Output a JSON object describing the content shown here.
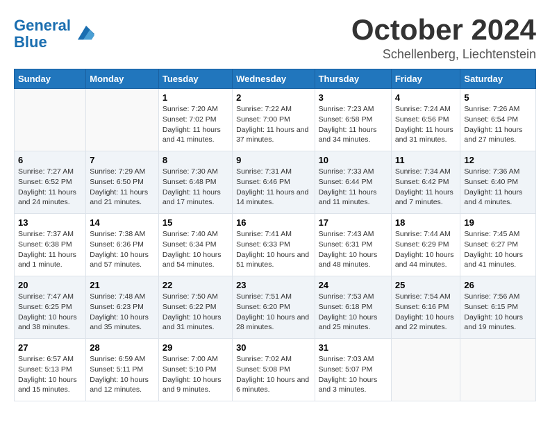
{
  "header": {
    "logo_line1": "General",
    "logo_line2": "Blue",
    "month": "October 2024",
    "location": "Schellenberg, Liechtenstein"
  },
  "weekdays": [
    "Sunday",
    "Monday",
    "Tuesday",
    "Wednesday",
    "Thursday",
    "Friday",
    "Saturday"
  ],
  "weeks": [
    [
      {
        "day": "",
        "sunrise": "",
        "sunset": "",
        "daylight": ""
      },
      {
        "day": "",
        "sunrise": "",
        "sunset": "",
        "daylight": ""
      },
      {
        "day": "1",
        "sunrise": "Sunrise: 7:20 AM",
        "sunset": "Sunset: 7:02 PM",
        "daylight": "Daylight: 11 hours and 41 minutes."
      },
      {
        "day": "2",
        "sunrise": "Sunrise: 7:22 AM",
        "sunset": "Sunset: 7:00 PM",
        "daylight": "Daylight: 11 hours and 37 minutes."
      },
      {
        "day": "3",
        "sunrise": "Sunrise: 7:23 AM",
        "sunset": "Sunset: 6:58 PM",
        "daylight": "Daylight: 11 hours and 34 minutes."
      },
      {
        "day": "4",
        "sunrise": "Sunrise: 7:24 AM",
        "sunset": "Sunset: 6:56 PM",
        "daylight": "Daylight: 11 hours and 31 minutes."
      },
      {
        "day": "5",
        "sunrise": "Sunrise: 7:26 AM",
        "sunset": "Sunset: 6:54 PM",
        "daylight": "Daylight: 11 hours and 27 minutes."
      }
    ],
    [
      {
        "day": "6",
        "sunrise": "Sunrise: 7:27 AM",
        "sunset": "Sunset: 6:52 PM",
        "daylight": "Daylight: 11 hours and 24 minutes."
      },
      {
        "day": "7",
        "sunrise": "Sunrise: 7:29 AM",
        "sunset": "Sunset: 6:50 PM",
        "daylight": "Daylight: 11 hours and 21 minutes."
      },
      {
        "day": "8",
        "sunrise": "Sunrise: 7:30 AM",
        "sunset": "Sunset: 6:48 PM",
        "daylight": "Daylight: 11 hours and 17 minutes."
      },
      {
        "day": "9",
        "sunrise": "Sunrise: 7:31 AM",
        "sunset": "Sunset: 6:46 PM",
        "daylight": "Daylight: 11 hours and 14 minutes."
      },
      {
        "day": "10",
        "sunrise": "Sunrise: 7:33 AM",
        "sunset": "Sunset: 6:44 PM",
        "daylight": "Daylight: 11 hours and 11 minutes."
      },
      {
        "day": "11",
        "sunrise": "Sunrise: 7:34 AM",
        "sunset": "Sunset: 6:42 PM",
        "daylight": "Daylight: 11 hours and 7 minutes."
      },
      {
        "day": "12",
        "sunrise": "Sunrise: 7:36 AM",
        "sunset": "Sunset: 6:40 PM",
        "daylight": "Daylight: 11 hours and 4 minutes."
      }
    ],
    [
      {
        "day": "13",
        "sunrise": "Sunrise: 7:37 AM",
        "sunset": "Sunset: 6:38 PM",
        "daylight": "Daylight: 11 hours and 1 minute."
      },
      {
        "day": "14",
        "sunrise": "Sunrise: 7:38 AM",
        "sunset": "Sunset: 6:36 PM",
        "daylight": "Daylight: 10 hours and 57 minutes."
      },
      {
        "day": "15",
        "sunrise": "Sunrise: 7:40 AM",
        "sunset": "Sunset: 6:34 PM",
        "daylight": "Daylight: 10 hours and 54 minutes."
      },
      {
        "day": "16",
        "sunrise": "Sunrise: 7:41 AM",
        "sunset": "Sunset: 6:33 PM",
        "daylight": "Daylight: 10 hours and 51 minutes."
      },
      {
        "day": "17",
        "sunrise": "Sunrise: 7:43 AM",
        "sunset": "Sunset: 6:31 PM",
        "daylight": "Daylight: 10 hours and 48 minutes."
      },
      {
        "day": "18",
        "sunrise": "Sunrise: 7:44 AM",
        "sunset": "Sunset: 6:29 PM",
        "daylight": "Daylight: 10 hours and 44 minutes."
      },
      {
        "day": "19",
        "sunrise": "Sunrise: 7:45 AM",
        "sunset": "Sunset: 6:27 PM",
        "daylight": "Daylight: 10 hours and 41 minutes."
      }
    ],
    [
      {
        "day": "20",
        "sunrise": "Sunrise: 7:47 AM",
        "sunset": "Sunset: 6:25 PM",
        "daylight": "Daylight: 10 hours and 38 minutes."
      },
      {
        "day": "21",
        "sunrise": "Sunrise: 7:48 AM",
        "sunset": "Sunset: 6:23 PM",
        "daylight": "Daylight: 10 hours and 35 minutes."
      },
      {
        "day": "22",
        "sunrise": "Sunrise: 7:50 AM",
        "sunset": "Sunset: 6:22 PM",
        "daylight": "Daylight: 10 hours and 31 minutes."
      },
      {
        "day": "23",
        "sunrise": "Sunrise: 7:51 AM",
        "sunset": "Sunset: 6:20 PM",
        "daylight": "Daylight: 10 hours and 28 minutes."
      },
      {
        "day": "24",
        "sunrise": "Sunrise: 7:53 AM",
        "sunset": "Sunset: 6:18 PM",
        "daylight": "Daylight: 10 hours and 25 minutes."
      },
      {
        "day": "25",
        "sunrise": "Sunrise: 7:54 AM",
        "sunset": "Sunset: 6:16 PM",
        "daylight": "Daylight: 10 hours and 22 minutes."
      },
      {
        "day": "26",
        "sunrise": "Sunrise: 7:56 AM",
        "sunset": "Sunset: 6:15 PM",
        "daylight": "Daylight: 10 hours and 19 minutes."
      }
    ],
    [
      {
        "day": "27",
        "sunrise": "Sunrise: 6:57 AM",
        "sunset": "Sunset: 5:13 PM",
        "daylight": "Daylight: 10 hours and 15 minutes."
      },
      {
        "day": "28",
        "sunrise": "Sunrise: 6:59 AM",
        "sunset": "Sunset: 5:11 PM",
        "daylight": "Daylight: 10 hours and 12 minutes."
      },
      {
        "day": "29",
        "sunrise": "Sunrise: 7:00 AM",
        "sunset": "Sunset: 5:10 PM",
        "daylight": "Daylight: 10 hours and 9 minutes."
      },
      {
        "day": "30",
        "sunrise": "Sunrise: 7:02 AM",
        "sunset": "Sunset: 5:08 PM",
        "daylight": "Daylight: 10 hours and 6 minutes."
      },
      {
        "day": "31",
        "sunrise": "Sunrise: 7:03 AM",
        "sunset": "Sunset: 5:07 PM",
        "daylight": "Daylight: 10 hours and 3 minutes."
      },
      {
        "day": "",
        "sunrise": "",
        "sunset": "",
        "daylight": ""
      },
      {
        "day": "",
        "sunrise": "",
        "sunset": "",
        "daylight": ""
      }
    ]
  ]
}
